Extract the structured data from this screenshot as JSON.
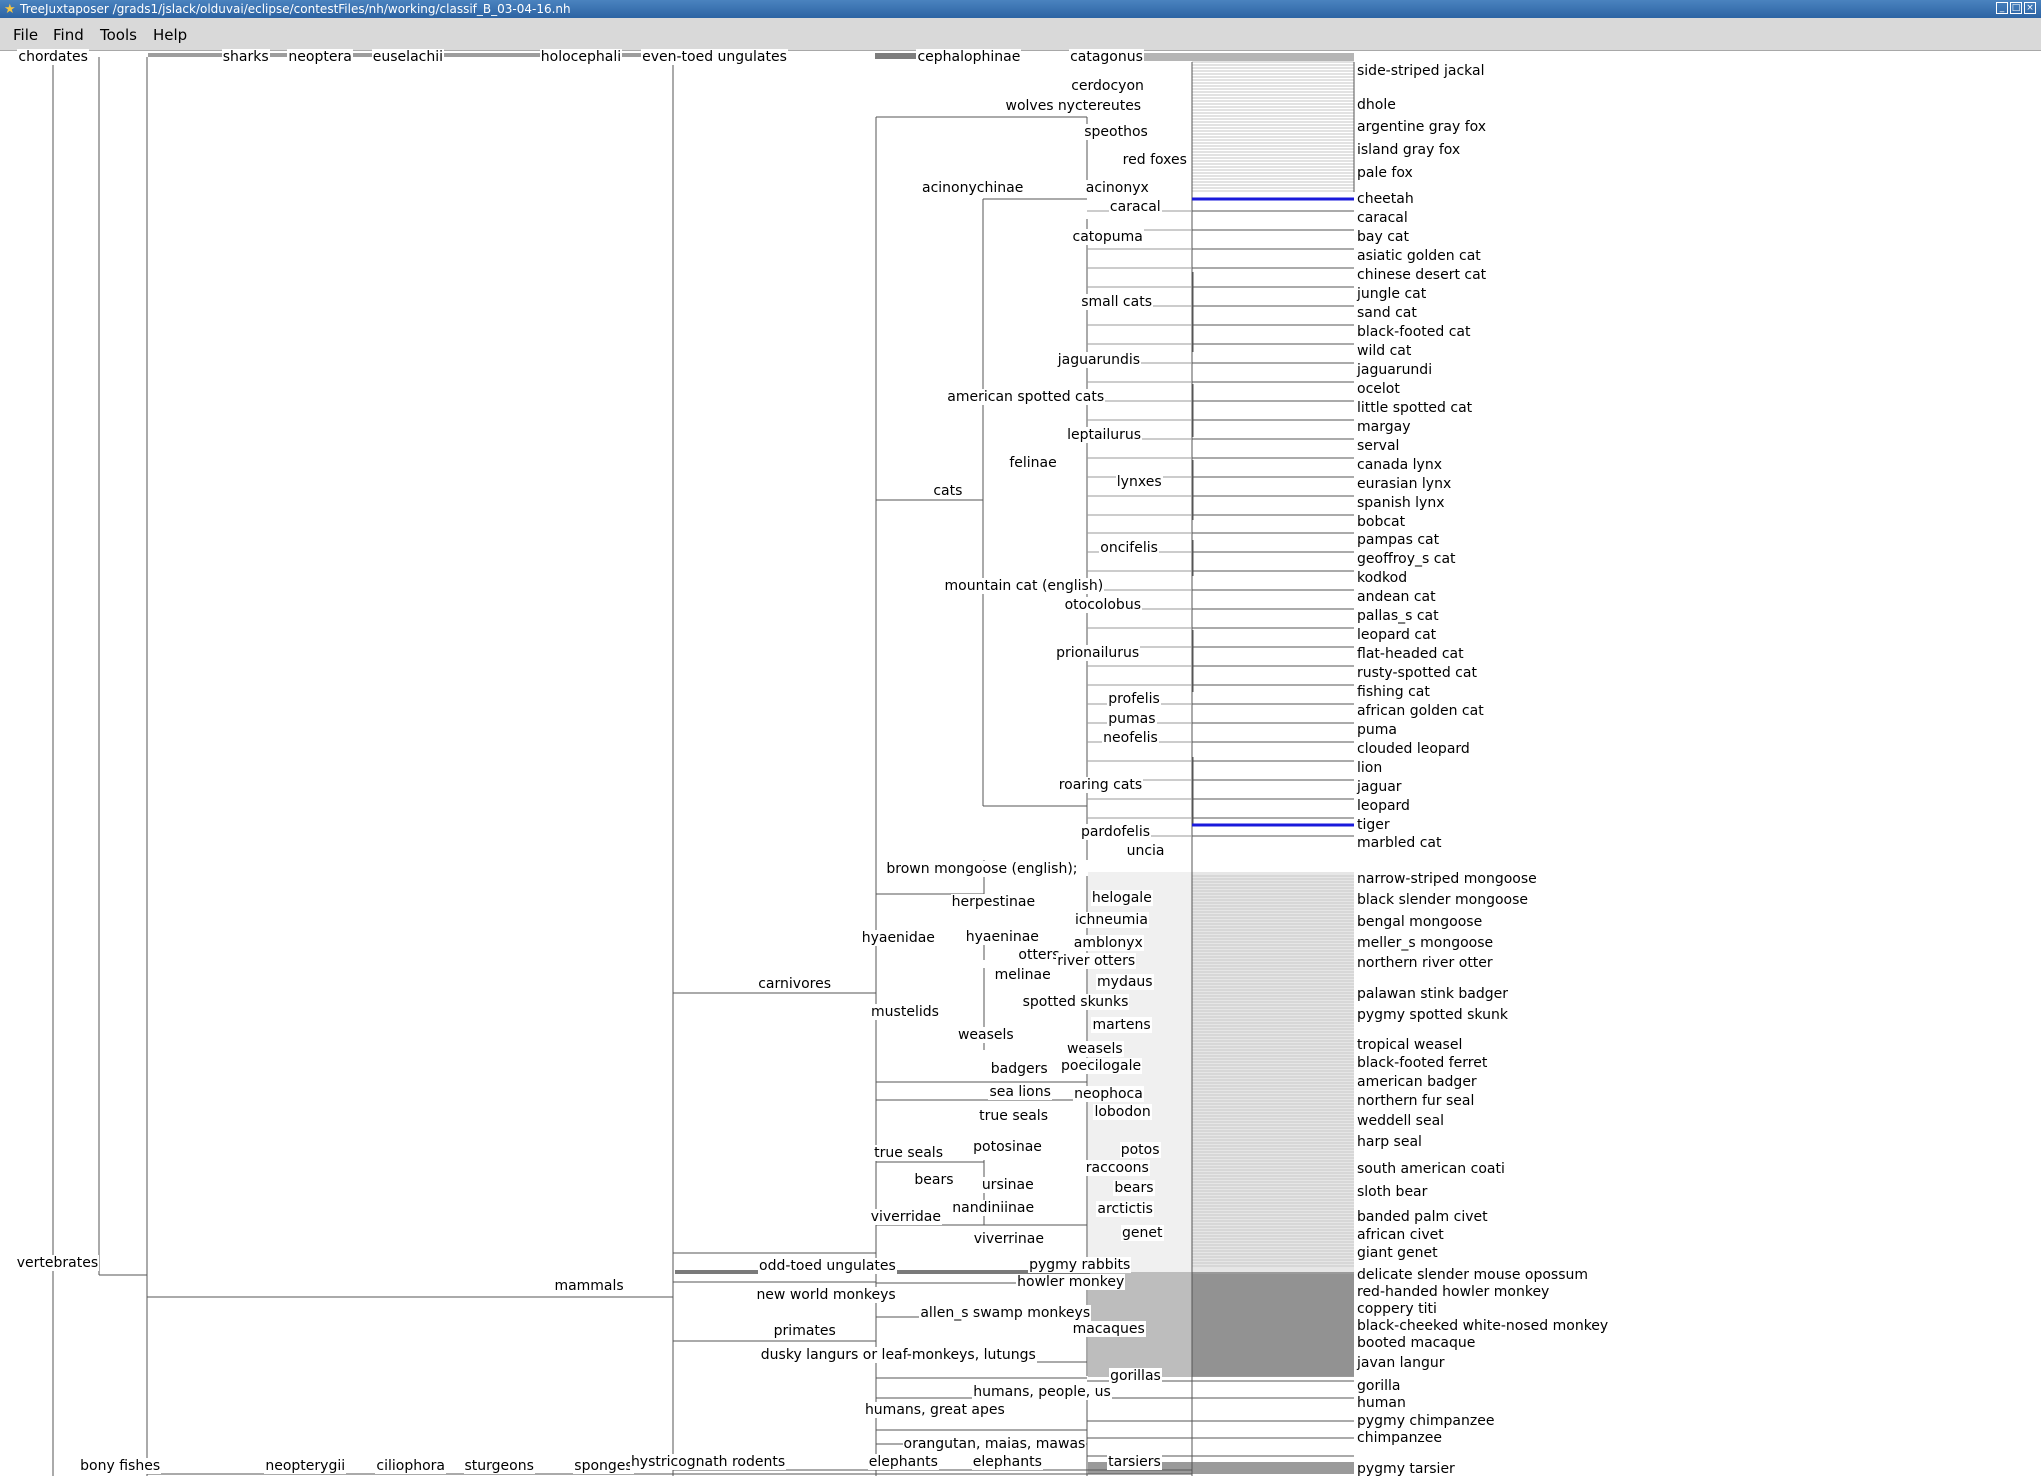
{
  "window": {
    "title": "TreeJuxtaposer /grads1/jslack/olduvai/eclipse/contestFiles/nh/working/classif_B_03-04-16.nh",
    "controls": [
      "minimize-icon",
      "maximize-icon",
      "close-icon"
    ]
  },
  "menu": {
    "file": "File",
    "find": "Find",
    "tools": "Tools",
    "help": "Help"
  },
  "colors": {
    "highlight": "#1a1adb",
    "edge": "#555555",
    "dense": "#9a9a9a"
  },
  "internal_labels": [
    "chordates",
    "sharks",
    "neoptera",
    "euselachii",
    "holocephali",
    "even-toed ungulates",
    "cephalophinae",
    "catagonus",
    "cerdocyon",
    "wolves",
    "nyctereutes",
    "speothos",
    "red foxes",
    "acinonychinae",
    "acinonyx",
    "caracal",
    "catopuma",
    "small cats",
    "jaguarundis",
    "american spotted cats",
    "leptailurus",
    "felinae",
    "lynxes",
    "cats",
    "oncifelis",
    "mountain cat (english)",
    "otocolobus",
    "prionailurus",
    "profelis",
    "pumas",
    "neofelis",
    "roaring cats",
    "pardofelis",
    "uncia",
    "brown mongoose (english);",
    "herpestinae",
    "helogale",
    "ichneumia",
    "hyaenidae",
    "hyaeninae",
    "amblonyx",
    "otters",
    "river otters",
    "melinae",
    "mydaus",
    "carnivores",
    "mustelids",
    "spotted skunks",
    "martens",
    "weasels",
    "weasels",
    "badgers",
    "poecilogale",
    "sea lions",
    "neophoca",
    "true seals",
    "lobodon",
    "true seals",
    "potosinae",
    "potos",
    "raccoons",
    "bears",
    "ursinae",
    "bears",
    "nandiniinae",
    "arctictis",
    "viverridae",
    "genet",
    "viverrinae",
    "vertebrates",
    "odd-toed ungulates",
    "pygmy rabbits",
    "howler monkey",
    "mammals",
    "new world monkeys",
    "allen_s swamp monkeys",
    "primates",
    "macaques",
    "dusky langurs or leaf-monkeys, lutungs",
    "gorillas",
    "humans, people, us",
    "humans, great apes",
    "orangutan, maias, mawas",
    "bony fishes",
    "neopterygii",
    "ciliophora",
    "sturgeons",
    "sponges",
    "hystricognath rodents",
    "elephants",
    "elephants",
    "tarsiers"
  ],
  "leaf_labels": [
    "side-striped jackal",
    "dhole",
    "argentine gray fox",
    "island gray fox",
    "pale fox",
    "cheetah",
    "caracal",
    "bay cat",
    "asiatic golden cat",
    "chinese desert cat",
    "jungle cat",
    "sand cat",
    "black-footed cat",
    "wild cat",
    "jaguarundi",
    "ocelot",
    "little spotted cat",
    "margay",
    "serval",
    "canada lynx",
    "eurasian lynx",
    "spanish lynx",
    "bobcat",
    "pampas cat",
    "geoffroy_s cat",
    "kodkod",
    "andean cat",
    "pallas_s cat",
    "leopard cat",
    "flat-headed cat",
    "rusty-spotted cat",
    "fishing cat",
    "african golden cat",
    "puma",
    "clouded leopard",
    "lion",
    "jaguar",
    "leopard",
    "tiger",
    "marbled cat",
    "narrow-striped mongoose",
    "black slender mongoose",
    "bengal mongoose",
    "meller_s mongoose",
    "northern river otter",
    "palawan stink badger",
    "pygmy spotted skunk",
    "tropical weasel",
    "black-footed ferret",
    "american badger",
    "northern fur seal",
    "weddell seal",
    "harp seal",
    "south american coati",
    "sloth bear",
    "banded palm civet",
    "african civet",
    "giant genet",
    "delicate slender mouse opossum",
    "red-handed howler monkey",
    "coppery titi",
    "black-cheeked white-nosed monkey",
    "booted macaque",
    "javan langur",
    "gorilla",
    "human",
    "pygmy chimpanzee",
    "chimpanzee",
    "pygmy tarsier"
  ],
  "highlighted_leaves": [
    "cheetah",
    "tiger"
  ]
}
